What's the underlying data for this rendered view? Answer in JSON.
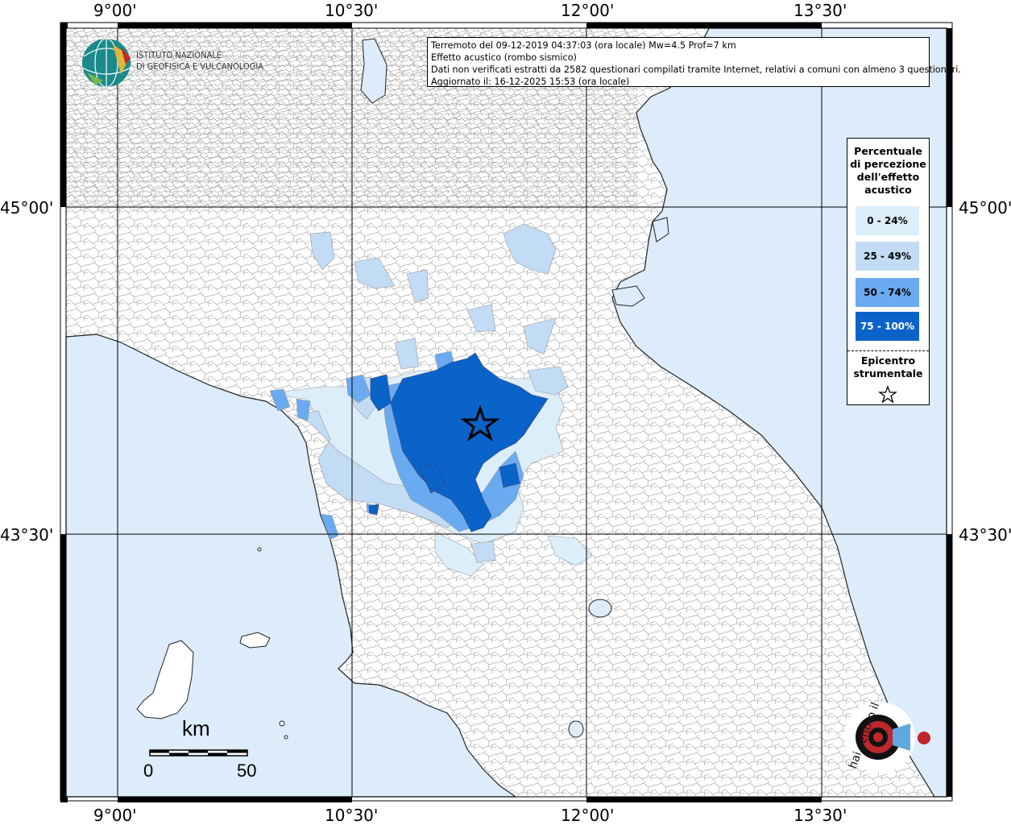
{
  "map": {
    "info": {
      "line1": "Terremoto del 09-12-2019 04:37:03 (ora locale) Mw=4.5 Prof=7 km",
      "line2": "Effetto acustico (rombo sismico)",
      "line3": "Dati non verificati estratti da 2582 questionari compilati tramite Internet, relativi a comuni con almeno 3 questionari.",
      "line4": "Aggiornato il: 16-12-2025 15:53 (ora locale)"
    },
    "lon_labels": [
      "9°00'",
      "10°30'",
      "12°00'",
      "13°30'"
    ],
    "lat_labels": [
      "45°00'",
      "43°30'"
    ],
    "logo": {
      "line1": "ISTITUTO NAZIONALE",
      "line2": "DI GEOFISICA E VULCANOLOGIA"
    },
    "scale": {
      "unit": "km",
      "min": "0",
      "max": "50"
    },
    "badge": {
      "text": "haisentitoilterremoto.it",
      "url": "www."
    }
  },
  "legend": {
    "title": "Percentuale di percezione dell'effetto acustico",
    "title_lines": [
      "Percentuale",
      "di percezione",
      "dell'effetto",
      "acustico"
    ],
    "items": [
      {
        "label": "0 - 24%",
        "color": "#ddeefb"
      },
      {
        "label": "25 - 49%",
        "color": "#c3dcf5"
      },
      {
        "label": "50 - 74%",
        "color": "#6aaaf0"
      },
      {
        "label": "75 - 100%",
        "color": "#0a63c9"
      }
    ],
    "epicenter_lines": [
      "Epicentro",
      "strumentale"
    ]
  },
  "colors": {
    "sea": "#dcecfa",
    "land": "#ffffff",
    "border": "#8a8a8a",
    "grid": "#000000"
  }
}
